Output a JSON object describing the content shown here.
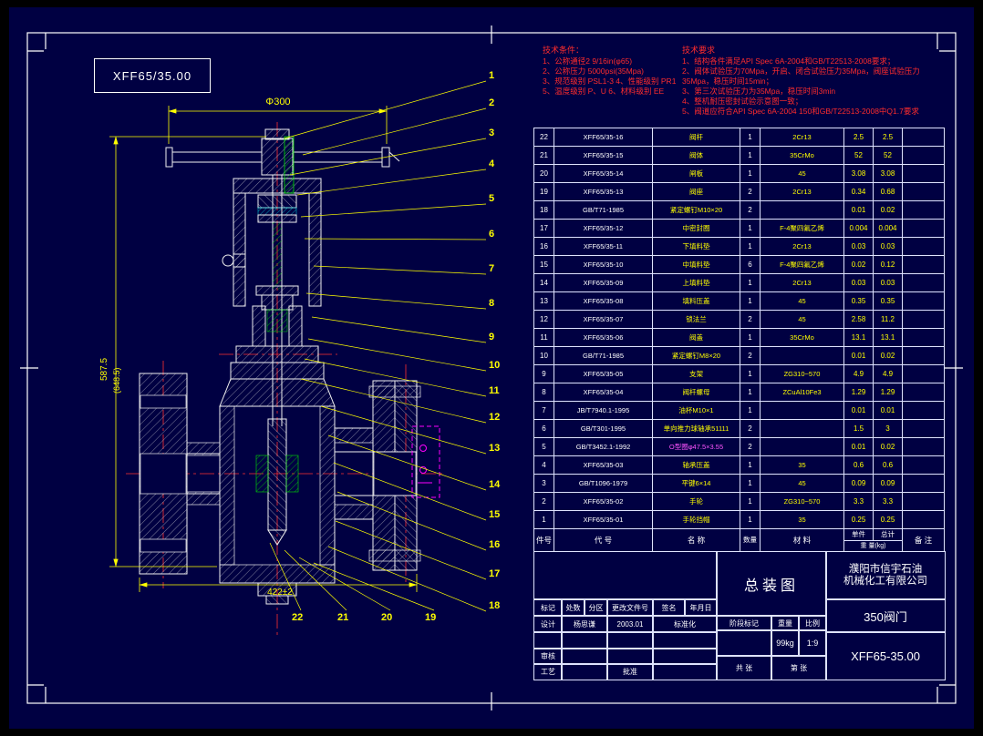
{
  "palette": {
    "background": "#000042",
    "line": "#ffffff",
    "dimension": "#ffff00",
    "notes": "#ff2c2c",
    "highlight": "#00e000",
    "aux": "#00e0e0",
    "detail": "#ff00ff"
  },
  "sheet": {
    "drawing_no_box": "XFF65/35.00"
  },
  "tech_conditions": {
    "title": "技术条件：",
    "lines": [
      "1、公称通径2 9/16in(φ65)",
      "2、公称压力 5000psi(35Mpa)",
      "3、规范级别 PSL1-3  4、性能级别 PR1",
      "5、温度级别 P、U  6、材料级别 EE"
    ]
  },
  "tech_requirements": {
    "title": "技术要求",
    "lines": [
      "1、结构各件满足API Spec 6A-2004和GB/T22513-2008要求；",
      "2、阀体试验压力70Mpa，开启、闭合试验压力35Mpa，阀座试验压力35Mpa，稳压时间15min；",
      "3、第三次试验压力为35Mpa，稳压时间3min",
      "4、整机耐压密封试验示意图一致；",
      "5、阀道应符合API Spec 6A-2004 150和GB/T22513-2008中Q1.7要求"
    ]
  },
  "dimensions": {
    "top_diameter": "Φ300",
    "left_height": "587.5",
    "left_height_ref": "(648.5)",
    "bottom_width": "422±2"
  },
  "balloons": {
    "right": [
      "1",
      "2",
      "3",
      "4",
      "5",
      "6",
      "7",
      "8",
      "9",
      "10",
      "11",
      "12",
      "13",
      "14",
      "15",
      "16",
      "17",
      "18"
    ],
    "bottom": [
      "22",
      "21",
      "20",
      "19"
    ]
  },
  "parts_table": {
    "headers": {
      "no": "件号",
      "code": "代  号",
      "name": "名  称",
      "qty": "数量",
      "material": "材  料",
      "unit": "单件",
      "total": "总计",
      "weight": "重 量(kg)",
      "note": "备 注"
    },
    "rows": [
      [
        "22",
        "XFF65/35-16",
        "阀杆",
        "1",
        "2Cr13",
        "2.5",
        "2.5",
        ""
      ],
      [
        "21",
        "XFF65/35-15",
        "阀体",
        "1",
        "35CrMo",
        "52",
        "52",
        ""
      ],
      [
        "20",
        "XFF65/35-14",
        "闸板",
        "1",
        "45",
        "3.08",
        "3.08",
        ""
      ],
      [
        "19",
        "XFF65/35-13",
        "阀座",
        "2",
        "2Cr13",
        "0.34",
        "0.68",
        ""
      ],
      [
        "18",
        "GB/T71-1985",
        "紧定螺钉M10×20",
        "2",
        "",
        "0.01",
        "0.02",
        ""
      ],
      [
        "17",
        "XFF65/35-12",
        "中密封圈",
        "1",
        "F-4聚四氟乙烯",
        "0.004",
        "0.004",
        ""
      ],
      [
        "16",
        "XFF65/35-11",
        "下填料垫",
        "1",
        "2Cr13",
        "0.03",
        "0.03",
        ""
      ],
      [
        "15",
        "XFF65/35-10",
        "中填料垫",
        "6",
        "F-4聚四氟乙烯",
        "0.02",
        "0.12",
        ""
      ],
      [
        "14",
        "XFF65/35-09",
        "上填料垫",
        "1",
        "2Cr13",
        "0.03",
        "0.03",
        ""
      ],
      [
        "13",
        "XFF65/35-08",
        "填料压盖",
        "1",
        "45",
        "0.35",
        "0.35",
        ""
      ],
      [
        "12",
        "XFF65/35-07",
        "锁法兰",
        "2",
        "45",
        "2.58",
        "11.2",
        ""
      ],
      [
        "11",
        "XFF65/35-06",
        "阀盖",
        "1",
        "35CrMo",
        "13.1",
        "13.1",
        ""
      ],
      [
        "10",
        "GB/T71-1985",
        "紧定螺钉M8×20",
        "2",
        "",
        "0.01",
        "0.02",
        ""
      ],
      [
        "9",
        "XFF65/35-05",
        "支架",
        "1",
        "ZG310~570",
        "4.9",
        "4.9",
        ""
      ],
      [
        "8",
        "XFF65/35-04",
        "阀杆螺母",
        "1",
        "ZCuAl10Fe3",
        "1.29",
        "1.29",
        ""
      ],
      [
        "7",
        "JB/T7940.1-1995",
        "油杯M10×1",
        "1",
        "",
        "0.01",
        "0.01",
        ""
      ],
      [
        "6",
        "GB/T301-1995",
        "单向推力球轴承51111",
        "2",
        "",
        "1.5",
        "3",
        ""
      ],
      [
        "5",
        "GB/T3452.1-1992",
        "O型圈φ47.5×3.55",
        "2",
        "",
        "0.01",
        "0.02",
        ""
      ],
      [
        "4",
        "XFF65/35-03",
        "轴承压盖",
        "1",
        "35",
        "0.6",
        "0.6",
        ""
      ],
      [
        "3",
        "GB/T1096-1979",
        "平键6×14",
        "1",
        "45",
        "0.09",
        "0.09",
        ""
      ],
      [
        "2",
        "XFF65/35-02",
        "手轮",
        "1",
        "ZG310~570",
        "3.3",
        "3.3",
        ""
      ],
      [
        "1",
        "XFF65/35-01",
        "手轮挡帽",
        "1",
        "35",
        "0.25",
        "0.25",
        ""
      ]
    ]
  },
  "title_block": {
    "main_title": "总装图",
    "company_line1": "濮阳市信宇石油",
    "company_line2": "机械化工有限公司",
    "product": "350阀门",
    "drawing_no": "XFF65-35.00",
    "stage_label": "阶段标记",
    "weight_label": "重量",
    "scale_label": "比例",
    "weight_value": "99kg",
    "scale_value": "1:9",
    "sheets_total": "共  张",
    "sheet_no": "第  张",
    "rev_headers": [
      "标记",
      "处数",
      "分区",
      "更改文件号",
      "签名",
      "年月日"
    ],
    "design_label": "设计",
    "designer": "杨思谦",
    "design_date": "2003.01",
    "standard_label": "标准化",
    "check_label": "审核",
    "process_label": "工艺",
    "approve_label": "批准"
  }
}
